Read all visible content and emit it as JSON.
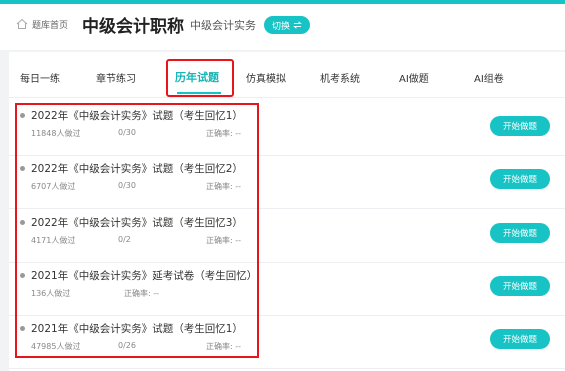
{
  "header": {
    "home_label": "题库首页",
    "title": "中级会计职称",
    "subject": "中级会计实务",
    "switch_label": "切换",
    "switch_icon": "swap-icon"
  },
  "tabs": [
    {
      "label": "每日一练"
    },
    {
      "label": "章节练习"
    },
    {
      "label": "历年试题",
      "active": true
    },
    {
      "label": "仿真模拟"
    },
    {
      "label": "机考系统"
    },
    {
      "label": "AI做题"
    },
    {
      "label": "AI组卷"
    }
  ],
  "exams": [
    {
      "title": "2022年《中级会计实务》试题（考生回忆1）",
      "done": "11848人做过",
      "progress": "0/30",
      "accuracy": "正确率: --",
      "button": "开始做题"
    },
    {
      "title": "2022年《中级会计实务》试题（考生回忆2）",
      "done": "6707人做过",
      "progress": "0/30",
      "accuracy": "正确率: --",
      "button": "开始做题"
    },
    {
      "title": "2022年《中级会计实务》试题（考生回忆3）",
      "done": "4171人做过",
      "progress": "0/2",
      "accuracy": "正确率: --",
      "button": "开始做题"
    },
    {
      "title": "2021年《中级会计实务》延考试卷（考生回忆）",
      "done": "136人做过",
      "progress": "",
      "accuracy": "正确率: --",
      "button": "开始做题"
    },
    {
      "title": "2021年《中级会计实务》试题（考生回忆1）",
      "done": "47985人做过",
      "progress": "0/26",
      "accuracy": "正确率: --",
      "button": "开始做题"
    }
  ],
  "colors": {
    "accent": "#17c3c4",
    "highlight": "#e6161a"
  }
}
